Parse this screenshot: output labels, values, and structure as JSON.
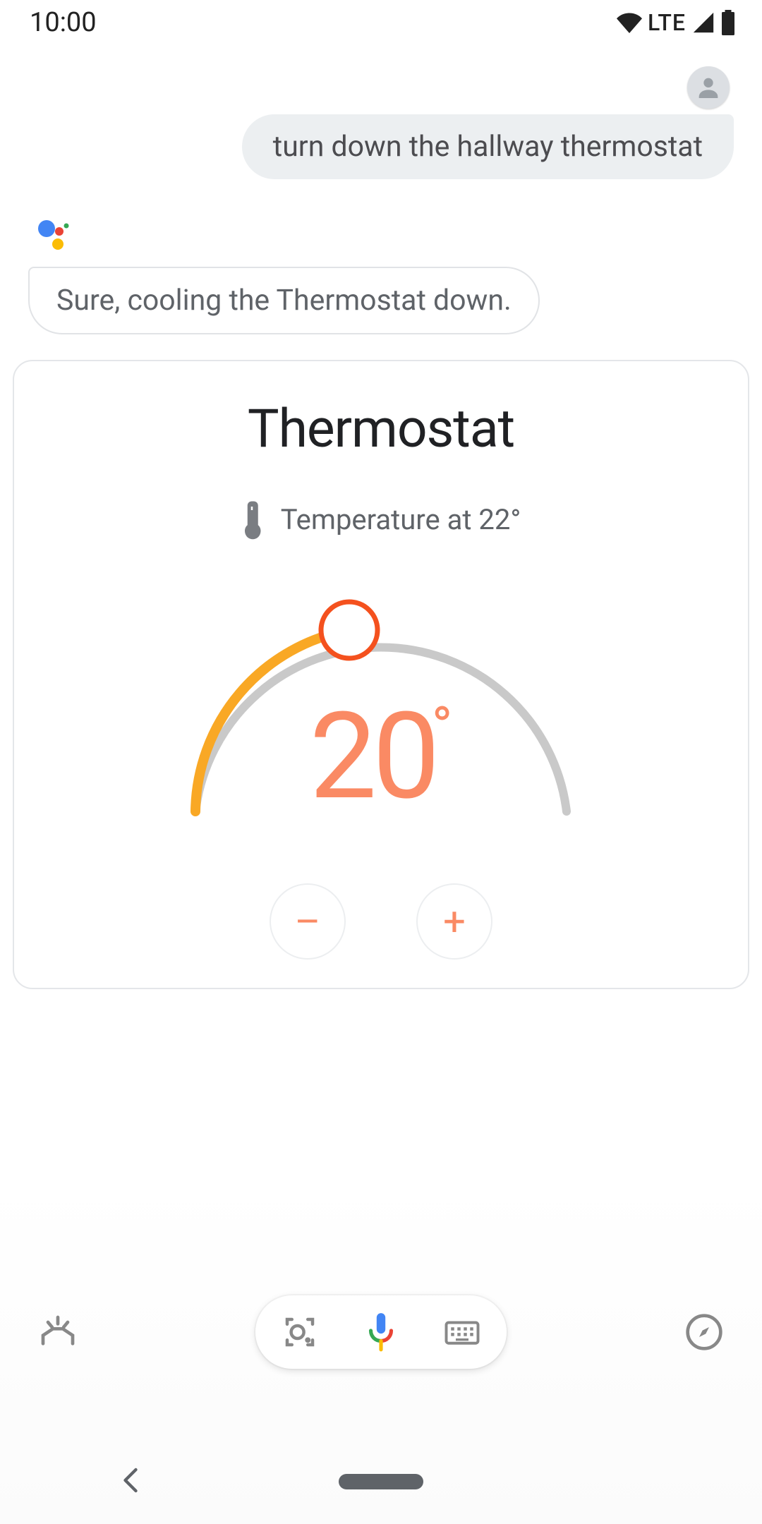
{
  "statusbar": {
    "time": "10:00",
    "network_label": "LTE"
  },
  "conversation": {
    "user_text": "turn down the hallway thermostat",
    "assistant_text": "Sure, cooling the Thermostat down."
  },
  "card": {
    "title": "Thermostat",
    "current_temp_text": "Temperature at 22°",
    "setpoint_value": "20",
    "setpoint_unit": "°",
    "minus_label": "–",
    "plus_label": "+"
  },
  "colors": {
    "accent": "#fa8a64",
    "arc_active": "#f9a825",
    "arc_inactive": "#c9c9c9",
    "grey_text": "#5f6368"
  },
  "icons": {
    "avatar": "person-icon",
    "assistant": "assistant-dots-icon",
    "thermometer": "thermometer-icon",
    "updates": "updates-icon",
    "lens": "lens-icon",
    "mic": "mic-icon",
    "keyboard": "keyboard-icon",
    "explore": "compass-icon"
  }
}
